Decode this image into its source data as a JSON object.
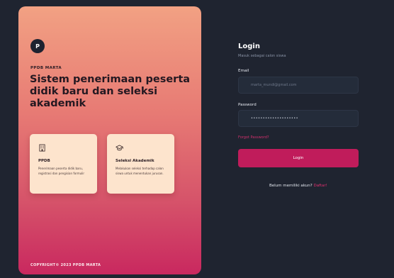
{
  "hero": {
    "logo_letter": "P",
    "brand": "PPDB MARTA",
    "headline": "Sistem penerimaan peserta didik baru dan seleksi akademik",
    "cards": [
      {
        "icon": "building-icon",
        "title": "PPDB",
        "description": "Penerimaan peserta didik baru, registrasi dan pengisian formulir"
      },
      {
        "icon": "graduation-cap-icon",
        "title": "Seleksi Akademik",
        "description": "Melakukan seleksi terhadap calon siswa untuk menentukan jurusan."
      }
    ],
    "copyright": "COPYRIGHT© 2023 PPDB MARTA"
  },
  "login": {
    "title": "Login",
    "subtitle": "Masuk sebagai calon siswa",
    "email_label": "Email",
    "email_placeholder": "marta_mundi@gmail.com",
    "password_label": "Password",
    "password_value": "••••••••••••••••••••",
    "forgot_link": "Forgot Password?",
    "login_button": "Login",
    "register_prompt": "Belum memiliki akun?",
    "register_link": "Daftar!"
  },
  "colors": {
    "background": "#1f2430",
    "accent": "#c01c5b",
    "input_background": "#242c3a",
    "card_background": "#fde4cd"
  }
}
